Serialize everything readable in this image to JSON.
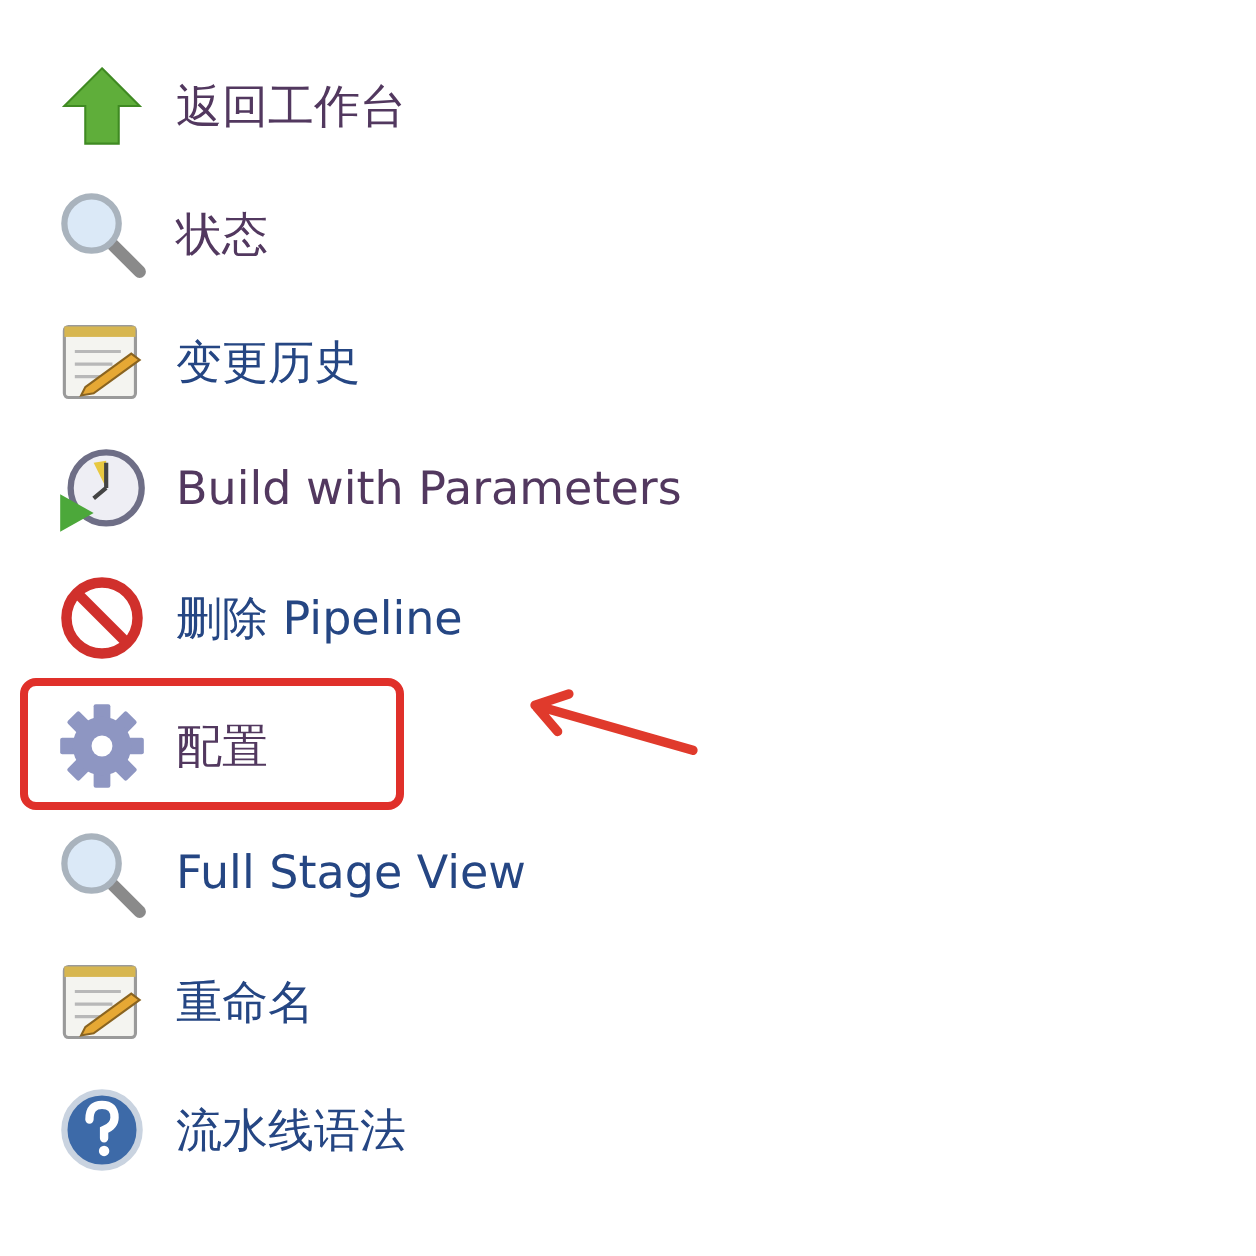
{
  "menu": [
    {
      "label": "返回工作台",
      "kind": "up",
      "visited": true,
      "highlighted": false
    },
    {
      "label": "状态",
      "kind": "search",
      "visited": true,
      "highlighted": false
    },
    {
      "label": "变更历史",
      "kind": "notepad",
      "visited": false,
      "highlighted": false
    },
    {
      "label": "Build with Parameters",
      "kind": "clock",
      "visited": true,
      "highlighted": false
    },
    {
      "label": "删除 Pipeline",
      "kind": "forbid",
      "visited": false,
      "highlighted": false
    },
    {
      "label": "配置",
      "kind": "gear",
      "visited": true,
      "highlighted": true
    },
    {
      "label": "Full Stage View",
      "kind": "search",
      "visited": false,
      "highlighted": false
    },
    {
      "label": "重命名",
      "kind": "notepad",
      "visited": false,
      "highlighted": false
    },
    {
      "label": "流水线语法",
      "kind": "help",
      "visited": false,
      "highlighted": false
    }
  ]
}
